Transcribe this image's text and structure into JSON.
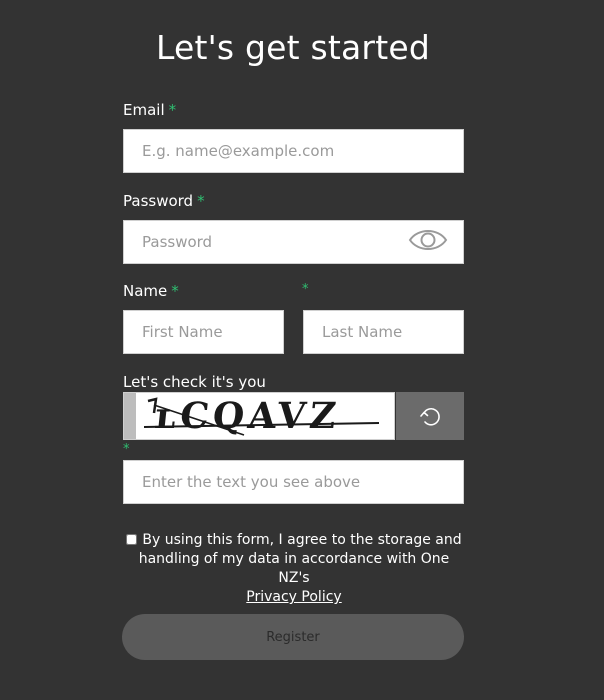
{
  "title": "Let's get started",
  "email": {
    "label": "Email",
    "required": "*",
    "placeholder": "E.g. name@example.com",
    "value": ""
  },
  "password": {
    "label": "Password",
    "required": "*",
    "placeholder": "Password",
    "value": "",
    "toggle_icon": "eye-icon"
  },
  "name": {
    "label": "Name",
    "required": "*",
    "first_placeholder": "First Name",
    "last_required": "*",
    "last_placeholder": "Last Name"
  },
  "captcha": {
    "label": "Let's check it's you",
    "image_text": "ʟCQAVZ",
    "refresh_icon": "refresh-icon",
    "required": "*",
    "placeholder": "Enter the text you see above",
    "value": ""
  },
  "consent": {
    "text": "By using this form, I agree to the storage and handling of my data in accordance with One NZ's",
    "link": "Privacy Policy",
    "checked": false
  },
  "register_label": "Register",
  "colors": {
    "background": "#333333",
    "required": "#2fbf71",
    "refresh_button": "#6b6b6b",
    "register_button": "#5a5a5a"
  }
}
